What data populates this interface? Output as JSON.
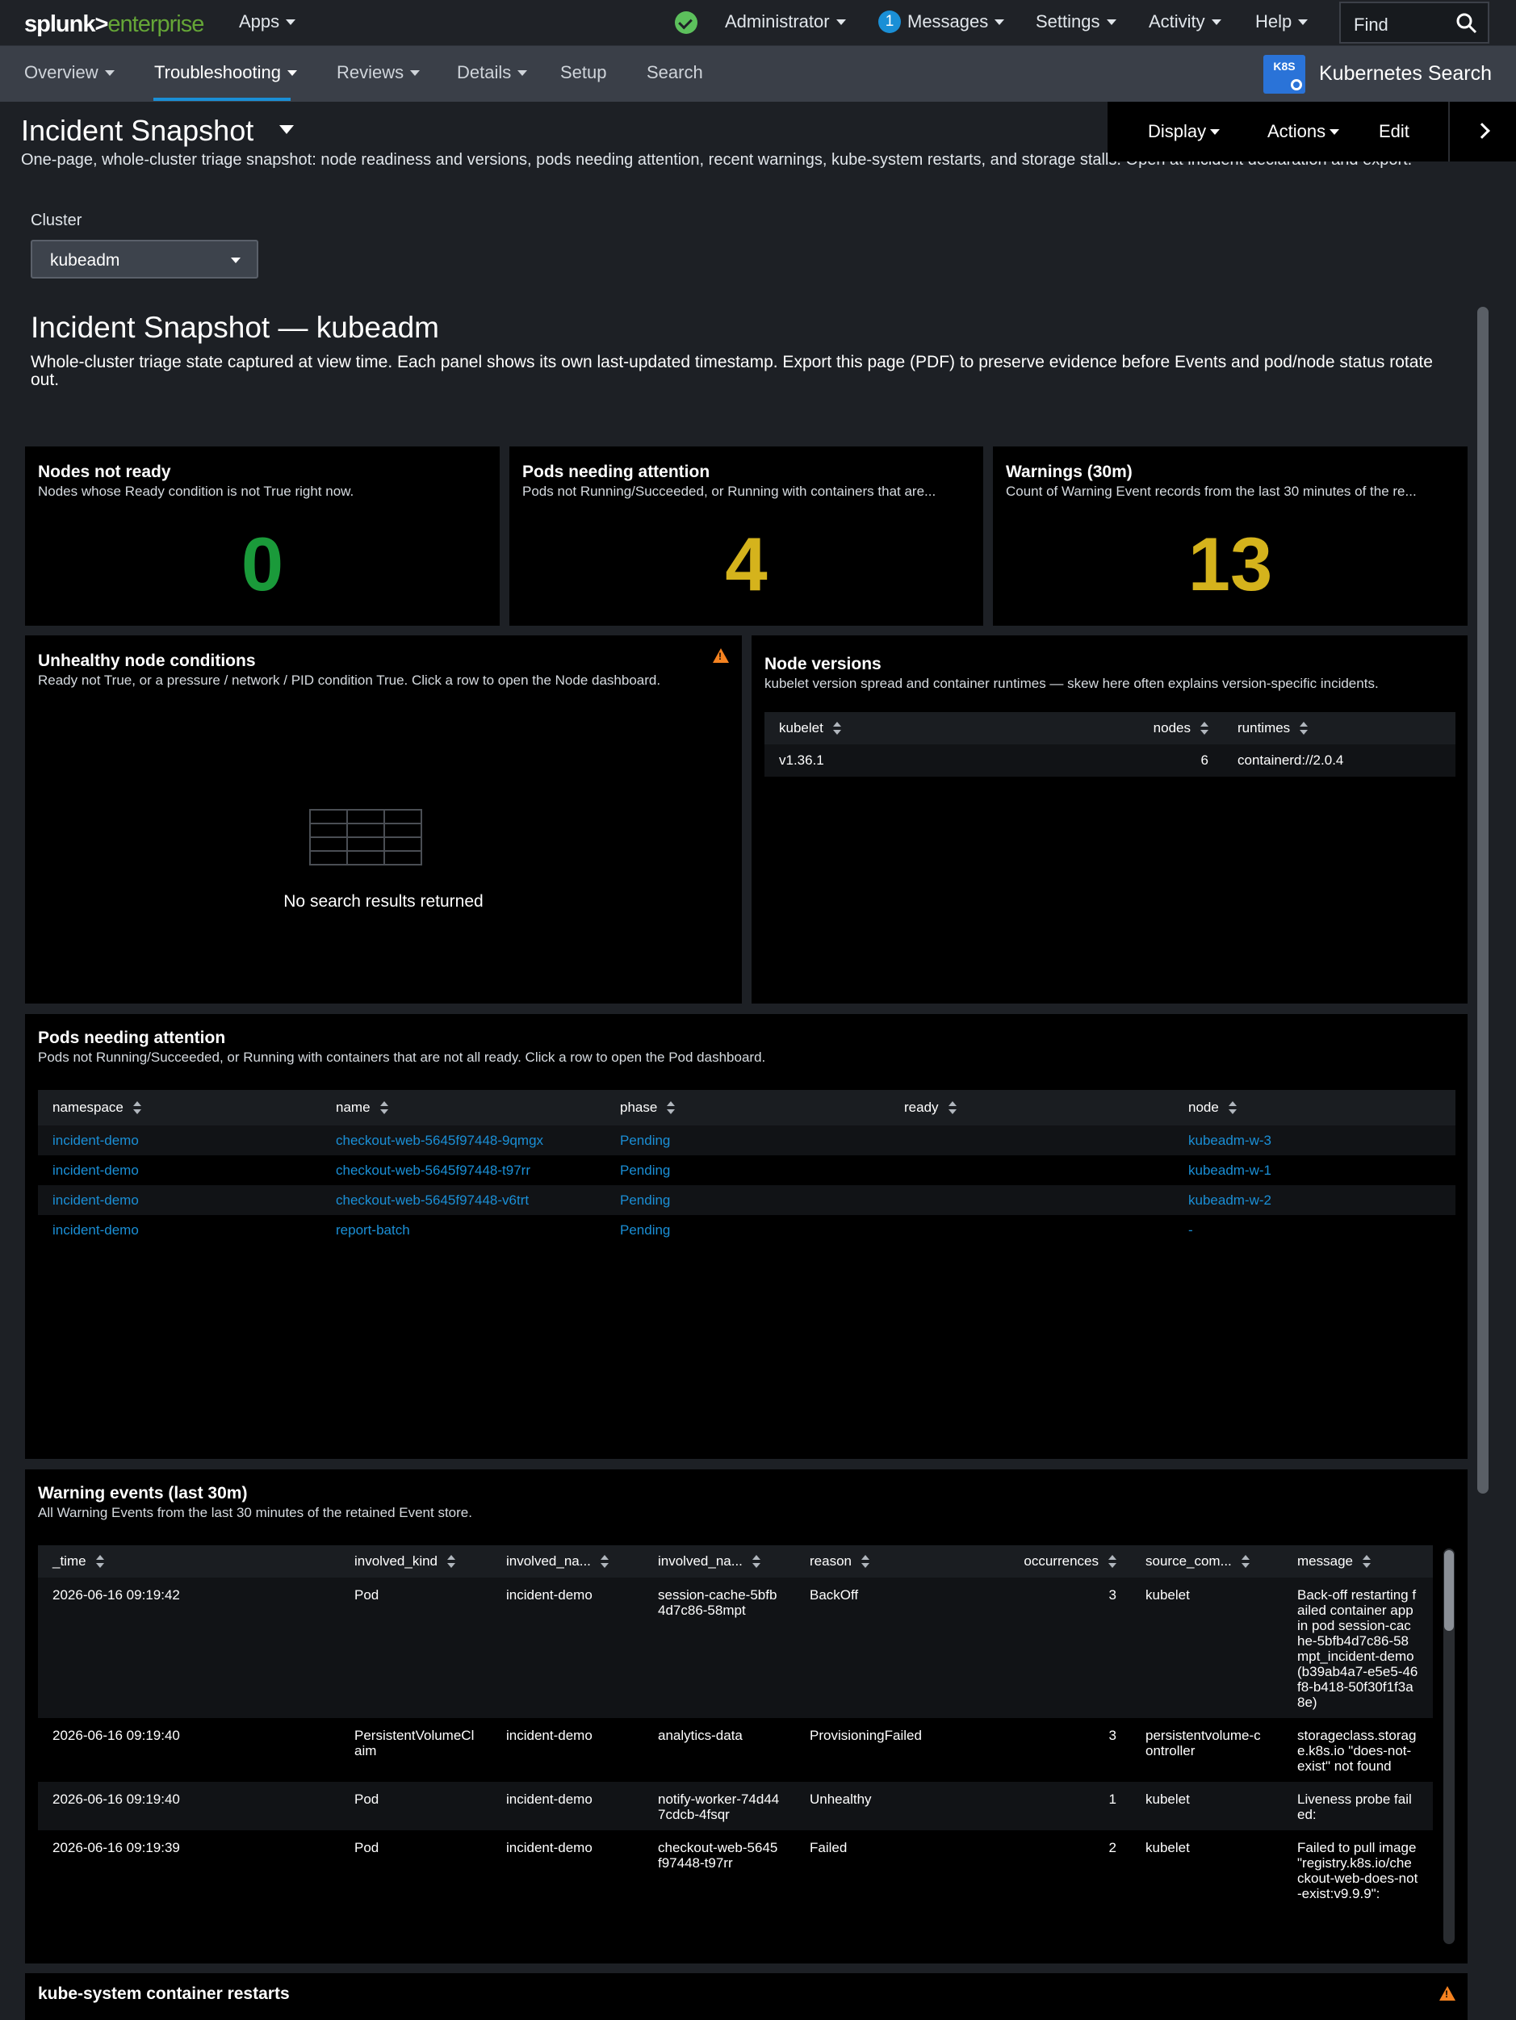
{
  "topbar": {
    "logo_main": "splunk>",
    "logo_sub": "enterprise",
    "apps": "Apps",
    "user": "Administrator",
    "messages_count": "1",
    "messages": "Messages",
    "settings": "Settings",
    "activity": "Activity",
    "help": "Help",
    "find_placeholder": "Find"
  },
  "appbar": {
    "tabs": [
      "Overview",
      "Troubleshooting",
      "Reviews",
      "Details",
      "Setup",
      "Search"
    ],
    "active_tab": "Troubleshooting",
    "logo_text": "K8S",
    "app_name": "Kubernetes Search"
  },
  "dashboard": {
    "title": "Incident Snapshot",
    "description": "One-page, whole-cluster triage snapshot: node readiness and versions, pods needing attention, recent warnings, kube-system restarts, and storage stalls. Open at incident declaration and export.",
    "edit_bar": {
      "display": "Display",
      "actions": "Actions",
      "edit": "Edit"
    }
  },
  "input": {
    "label": "Cluster",
    "value": "kubeadm"
  },
  "heading": {
    "title": "Incident Snapshot — kubeadm",
    "description": "Whole-cluster triage state captured at view time. Each panel shows its own last-updated timestamp. Export this page (PDF) to preserve evidence before Events and pod/node status rotate out."
  },
  "singles": [
    {
      "title": "Nodes not ready",
      "desc": "Nodes whose Ready condition is not True right now.",
      "value": "0",
      "color": "#1a9a3a"
    },
    {
      "title": "Pods needing attention",
      "desc": "Pods not Running/Succeeded, or Running with containers that are...",
      "value": "4",
      "color": "#d5b31c"
    },
    {
      "title": "Warnings (30m)",
      "desc": "Count of Warning Event records from the last 30 minutes of the re...",
      "value": "13",
      "color": "#d5b31c"
    }
  ],
  "unhealthy": {
    "title": "Unhealthy node conditions",
    "desc": "Ready not True, or a pressure / network / PID condition True. Click a row to open the Node dashboard.",
    "empty": "No search results returned"
  },
  "versions": {
    "title": "Node versions",
    "desc": "kubelet version spread and container runtimes — skew here often explains version-specific incidents.",
    "headers": [
      "kubelet",
      "nodes",
      "runtimes"
    ],
    "rows": [
      [
        "v1.36.1",
        "6",
        "containerd://2.0.4"
      ]
    ]
  },
  "pods": {
    "title": "Pods needing attention",
    "desc": "Pods not Running/Succeeded, or Running with containers that are not all ready. Click a row to open the Pod dashboard.",
    "headers": [
      "namespace",
      "name",
      "phase",
      "ready",
      "node"
    ],
    "rows": [
      [
        "incident-demo",
        "checkout-web-5645f97448-9qmgx",
        "Pending",
        "",
        "kubeadm-w-3"
      ],
      [
        "incident-demo",
        "checkout-web-5645f97448-t97rr",
        "Pending",
        "",
        "kubeadm-w-1"
      ],
      [
        "incident-demo",
        "checkout-web-5645f97448-v6trt",
        "Pending",
        "",
        "kubeadm-w-2"
      ],
      [
        "incident-demo",
        "report-batch",
        "Pending",
        "",
        "-"
      ]
    ]
  },
  "warnings": {
    "title": "Warning events (last 30m)",
    "desc": "All Warning Events from the last 30 minutes of the retained Event store.",
    "headers": [
      "_time",
      "involved_kind",
      "involved_na...",
      "involved_na...",
      "reason",
      "occurrences",
      "source_com...",
      "message"
    ],
    "rows": [
      [
        "2026-06-16 09:19:42",
        "Pod",
        "incident-demo",
        "session-cache-5bfb4d7c86-58mpt",
        "BackOff",
        "3",
        "kubelet",
        "Back-off restarting failed container app in pod session-cache-5bfb4d7c86-58mpt_incident-demo(b39ab4a7-e5e5-46f8-b418-50f30f1f3a8e)"
      ],
      [
        "2026-06-16 09:19:40",
        "PersistentVolumeClaim",
        "incident-demo",
        "analytics-data",
        "ProvisioningFailed",
        "3",
        "persistentvolume-controller",
        "storageclass.storage.k8s.io \"does-not-exist\" not found"
      ],
      [
        "2026-06-16 09:19:40",
        "Pod",
        "incident-demo",
        "notify-worker-74d447cdcb-4fsqr",
        "Unhealthy",
        "1",
        "kubelet",
        "Liveness probe failed:"
      ],
      [
        "2026-06-16 09:19:39",
        "Pod",
        "incident-demo",
        "checkout-web-5645f97448-t97rr",
        "Failed",
        "2",
        "kubelet",
        "Failed to pull image \"registry.k8s.io/checkout-web-does-not-exist:v9.9.9\":"
      ]
    ]
  },
  "restarts": {
    "title": "kube-system container restarts"
  }
}
